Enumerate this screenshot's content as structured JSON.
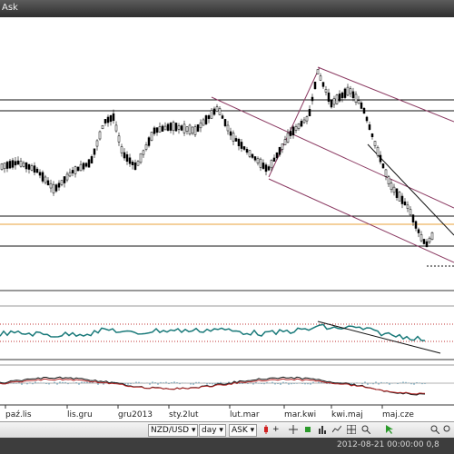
{
  "window": {
    "title": "Ask"
  },
  "chart": {
    "x_ticks": [
      "paź.lis",
      "lis.gru",
      "gru2013",
      "sty.2lut",
      "lut.mar",
      "mar.kwi",
      "kwi.maj",
      "maj.cze"
    ],
    "colors": {
      "candles": "#000000",
      "channel": "#8b3a62",
      "support_orange": "#e8a23a",
      "osc_line": "#1a7a7a",
      "osc_level": "#c03030",
      "macd_red": "#b02020"
    }
  },
  "toolbar": {
    "symbol": "NZD/USD",
    "period": "day",
    "quote": "ASK",
    "tab1": "+",
    "icons": [
      "candle-red-icon",
      "crosshair-icon",
      "candle-icon",
      "bar-chart-icon",
      "line-chart-icon",
      "grid-icon",
      "zoom-icon",
      "cursor-icon",
      "zoom-in-icon",
      "zoom-out-icon"
    ]
  },
  "status": {
    "text": "2012-08-21 00:00:00  0,8"
  }
}
